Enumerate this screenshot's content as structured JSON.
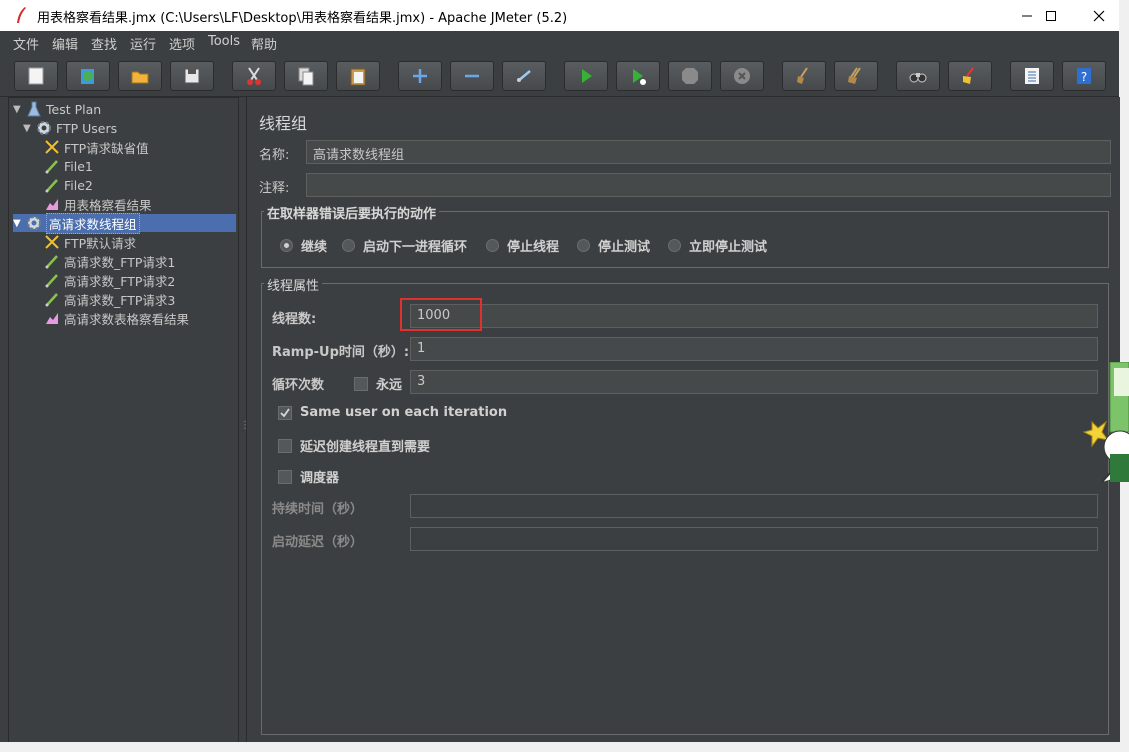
{
  "window": {
    "title": "用表格察看结果.jmx (C:\\Users\\LF\\Desktop\\用表格察看结果.jmx) - Apache JMeter (5.2)",
    "minimize": "—",
    "maximize": "☐",
    "close": "✕"
  },
  "menu": [
    "文件",
    "编辑",
    "查找",
    "运行",
    "选项",
    "Tools",
    "帮助"
  ],
  "toolbar": [
    {
      "name": "new-icon"
    },
    {
      "name": "templates-icon"
    },
    {
      "name": "open-icon"
    },
    {
      "name": "save-icon"
    },
    {
      "name": "cut-icon"
    },
    {
      "name": "copy-icon"
    },
    {
      "name": "paste-icon"
    },
    {
      "name": "expand-icon"
    },
    {
      "name": "collapse-icon"
    },
    {
      "name": "toggle-icon"
    },
    {
      "name": "start-icon"
    },
    {
      "name": "start-no-pause-icon"
    },
    {
      "name": "stop-icon"
    },
    {
      "name": "shutdown-icon"
    },
    {
      "name": "clear-icon"
    },
    {
      "name": "clear-all-icon"
    },
    {
      "name": "search-icon"
    },
    {
      "name": "reset-search-icon"
    },
    {
      "name": "function-helper-icon"
    },
    {
      "name": "help-icon"
    }
  ],
  "tree": {
    "items": [
      {
        "label": "Test Plan"
      },
      {
        "label": "FTP Users"
      },
      {
        "label": "FTP请求缺省值"
      },
      {
        "label": "File1"
      },
      {
        "label": "File2"
      },
      {
        "label": "用表格察看结果"
      },
      {
        "label": "高请求数线程组"
      },
      {
        "label": "FTP默认请求"
      },
      {
        "label": "高请求数_FTP请求1"
      },
      {
        "label": "高请求数_FTP请求2"
      },
      {
        "label": "高请求数_FTP请求3"
      },
      {
        "label": "高请求数表格察看结果"
      }
    ]
  },
  "panel": {
    "heading": "线程组",
    "name_label": "名称:",
    "name_value": "高请求数线程组",
    "comment_label": "注释:",
    "comment_value": "",
    "error_group_title": "在取样器错误后要执行的动作",
    "error_options": [
      "继续",
      "启动下一进程循环",
      "停止线程",
      "停止测试",
      "立即停止测试"
    ],
    "props_title": "线程属性",
    "threads_label": "线程数:",
    "threads_value": "1000",
    "rampup_label": "Ramp-Up时间（秒）:",
    "rampup_value": "1",
    "loop_label": "循环次数",
    "forever_label": "永远",
    "loop_value": "3",
    "same_user_label": "Same user on each iteration",
    "delay_label": "延迟创建线程直到需要",
    "scheduler_label": "调度器",
    "duration_label": "持续时间（秒）",
    "duration_value": "",
    "startup_delay_label": "启动延迟（秒）",
    "startup_delay_value": ""
  }
}
